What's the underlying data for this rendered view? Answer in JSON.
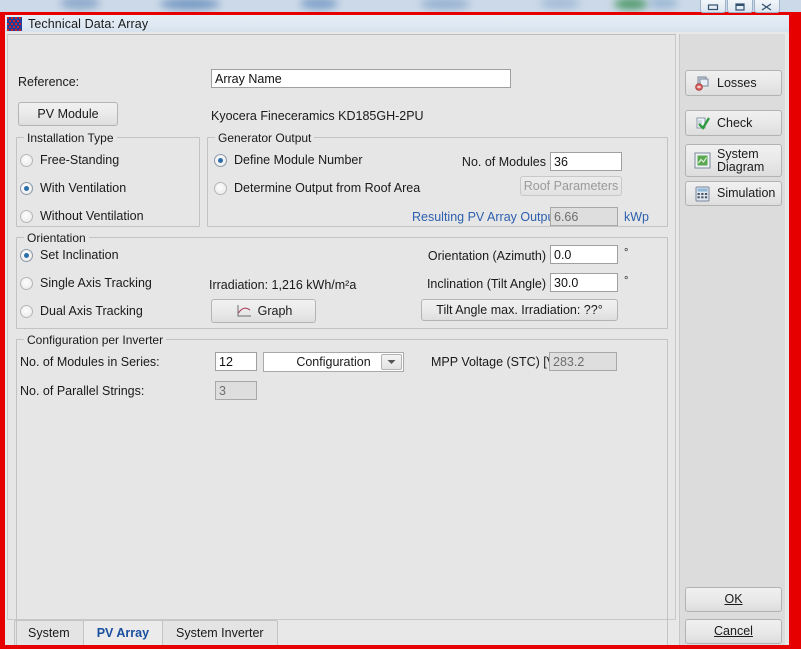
{
  "window": {
    "title": "Technical Data: Array",
    "icon": "app-grid-icon",
    "controls": [
      {
        "name": "minimize-button",
        "glyph": "minimize"
      },
      {
        "name": "maximize-button",
        "glyph": "maximize"
      },
      {
        "name": "close-button",
        "glyph": "close"
      }
    ]
  },
  "form": {
    "reference_label": "Reference:",
    "reference_value": "Array Name",
    "reference_placeholder": "Array Name",
    "pv_module_button": "PV Module",
    "pv_module_name": "Kyocera Fineceramics KD185GH-2PU"
  },
  "installation_type": {
    "legend": "Installation Type",
    "options": [
      {
        "label": "Free-Standing",
        "selected": false
      },
      {
        "label": "With Ventilation",
        "selected": true
      },
      {
        "label": "Without Ventilation",
        "selected": false
      }
    ]
  },
  "generator_output": {
    "legend": "Generator Output",
    "options": [
      {
        "label": "Define Module Number",
        "selected": true
      },
      {
        "label": "Determine Output from Roof Area",
        "selected": false
      }
    ],
    "no_of_modules_label": "No. of Modules",
    "no_of_modules_value": "36",
    "roof_parameters_button": "Roof Parameters",
    "roof_parameters_disabled": true,
    "resulting_output_label": "Resulting PV Array Output",
    "resulting_output_value": "6.66",
    "resulting_output_unit": "kWp",
    "accent_blue": "#2b5fae"
  },
  "orientation": {
    "legend": "Orientation",
    "options": [
      {
        "label": "Set Inclination",
        "selected": true
      },
      {
        "label": "Single Axis Tracking",
        "selected": false
      },
      {
        "label": "Dual Axis Tracking",
        "selected": false
      }
    ],
    "irradiation_text": "Irradiation: 1,216 kWh/m²a",
    "graph_button": "Graph",
    "azimuth_label": "Orientation (Azimuth)",
    "azimuth_value": "0.0",
    "azimuth_unit": "°",
    "tilt_label": "Inclination (Tilt Angle)",
    "tilt_value": "30.0",
    "tilt_unit": "°",
    "tilt_max_button": "Tilt Angle max. Irradiation: ??°"
  },
  "configuration": {
    "legend": "Configuration per Inverter",
    "modules_series_label": "No. of Modules in Series:",
    "modules_series_value": "12",
    "combo_selected": "Configuration",
    "combo_options": [
      "Configuration"
    ],
    "parallel_strings_label": "No. of Parallel Strings:",
    "parallel_strings_value": "3",
    "mpp_voltage_label": "MPP Voltage (STC) [V]:",
    "mpp_voltage_value": "283.2"
  },
  "sidebar": {
    "buttons": [
      {
        "label": "Losses",
        "icon": "losses-icon"
      },
      {
        "label": "Check",
        "icon": "check-icon"
      },
      {
        "label": "System\nDiagram",
        "line1": "System",
        "line2": "Diagram",
        "icon": "system-diagram-icon"
      },
      {
        "label": "Simulation",
        "icon": "simulation-icon"
      }
    ],
    "ok_button": "OK",
    "ok_mnemonic": "O",
    "cancel_button": "Cancel",
    "cancel_mnemonic": "C"
  },
  "tabs": [
    {
      "label": "System",
      "active": false
    },
    {
      "label": "PV Array",
      "active": true
    },
    {
      "label": "System Inverter",
      "active": false
    }
  ],
  "colors": {
    "annotation_red": "#e60000",
    "dialog_bg": "#e6e6e6",
    "accent_blue": "#1a4fa0"
  }
}
